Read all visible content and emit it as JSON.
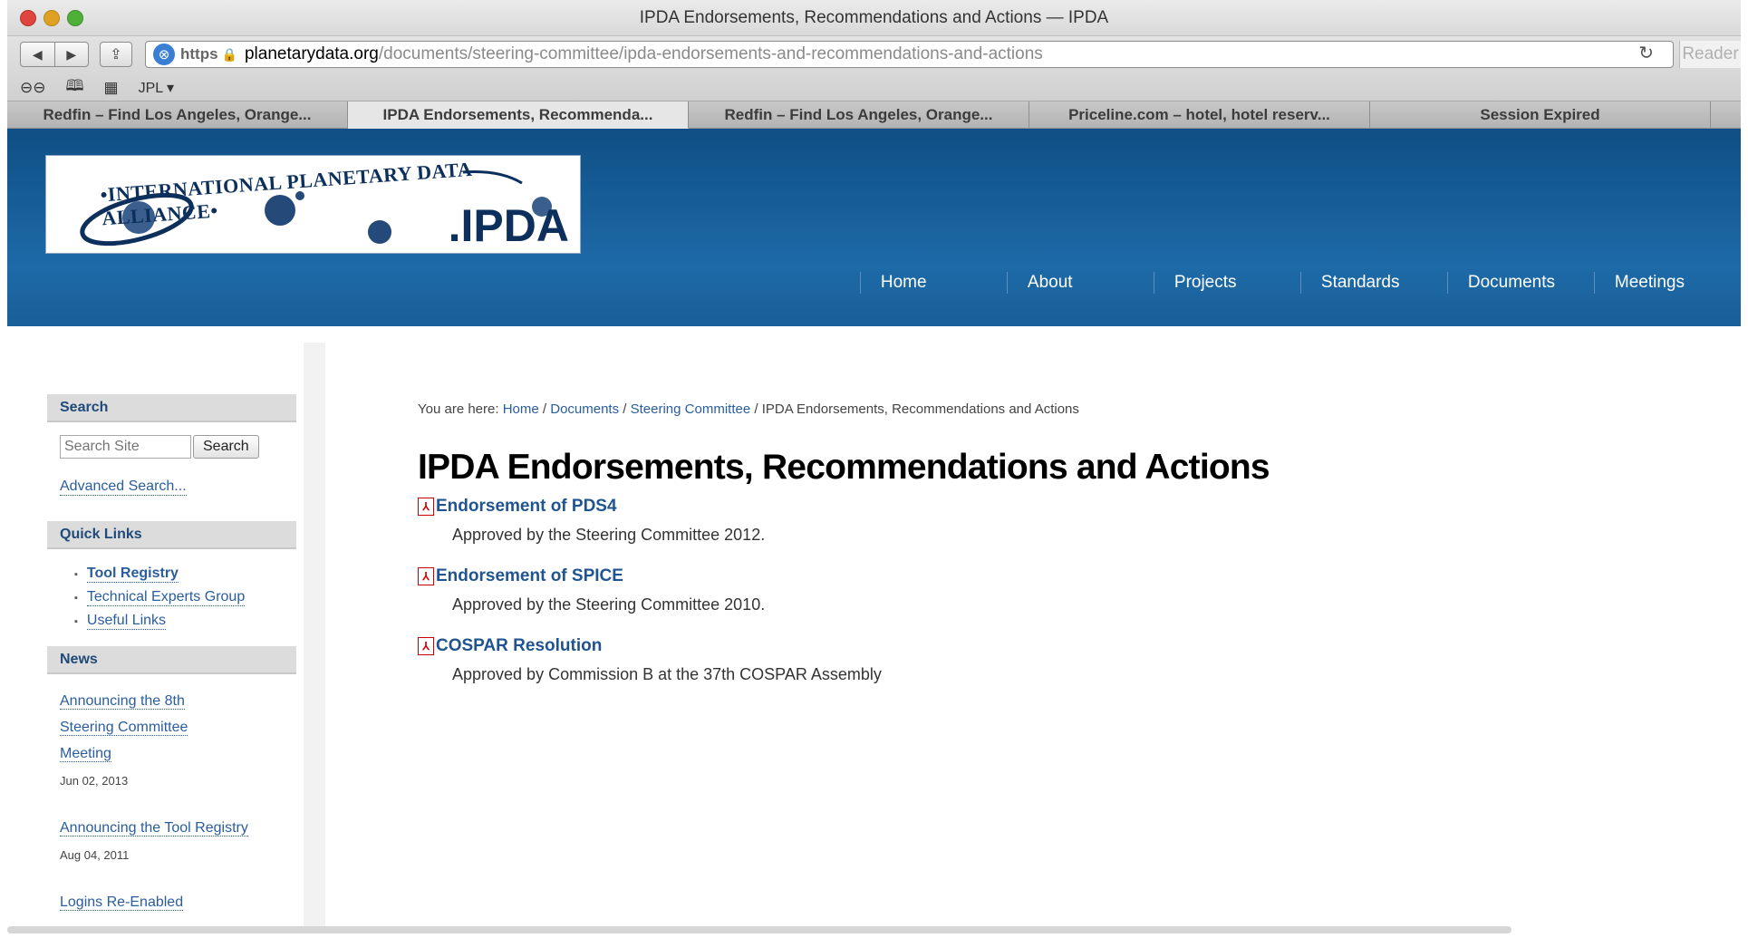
{
  "window": {
    "title": "IPDA Endorsements, Recommendations and Actions — IPDA"
  },
  "toolbar": {
    "back": "◀",
    "forward": "▶",
    "https": "https",
    "domain": "planetarydata.org",
    "path": "/documents/steering-committee/ipda-endorsements-and-recommendations-and-actions",
    "reader": "Reader",
    "bookmarks": [
      {
        "icon": "reading-list-icon",
        "glyph": "⊖⊖"
      },
      {
        "icon": "bookmarks-icon",
        "glyph": "🕮"
      },
      {
        "icon": "top-sites-icon",
        "glyph": "▦"
      }
    ],
    "bookmark_folder": "JPL ▾"
  },
  "tabs": [
    {
      "label": "Redfin – Find Los Angeles, Orange...",
      "active": false
    },
    {
      "label": "IPDA Endorsements, Recommenda...",
      "active": true
    },
    {
      "label": "Redfin – Find Los Angeles, Orange...",
      "active": false
    },
    {
      "label": "Priceline.com – hotel, hotel reserv...",
      "active": false
    },
    {
      "label": "Session Expired",
      "active": false
    }
  ],
  "site": {
    "logo_text": "•INTERNATIONAL PLANETARY DATA ALLIANCE•",
    "logo_ipda": ".IPDA",
    "nav": [
      "Home",
      "About",
      "Projects",
      "Standards",
      "Documents",
      "Meetings"
    ]
  },
  "sidebar": {
    "search_head": "Search",
    "search_placeholder": "Search Site",
    "search_button": "Search",
    "advanced": "Advanced Search...",
    "quicklinks_head": "Quick Links",
    "quicklinks": [
      "Tool Registry",
      "Technical Experts Group",
      "Useful Links"
    ],
    "news_head": "News",
    "news": [
      {
        "title": "Announcing the 8th Steering Committee Meeting",
        "date": "Jun 02, 2013"
      },
      {
        "title": "Announcing the Tool Registry",
        "date": "Aug 04, 2011"
      },
      {
        "title": "Logins Re-Enabled",
        "date": ""
      }
    ]
  },
  "main": {
    "breadcrumb_prefix": "You are here:",
    "crumbs": [
      "Home",
      "Documents",
      "Steering Committee"
    ],
    "crumb_current": "IPDA Endorsements, Recommendations and Actions",
    "title": "IPDA Endorsements, Recommendations and Actions",
    "docs": [
      {
        "title": "Endorsement of PDS4",
        "desc": "Approved by the Steering Committee 2012."
      },
      {
        "title": "Endorsement of SPICE",
        "desc": "Approved by the Steering Committee 2010."
      },
      {
        "title": "COSPAR Resolution",
        "desc": "Approved by Commission B at the 37th COSPAR Assembly"
      }
    ]
  }
}
